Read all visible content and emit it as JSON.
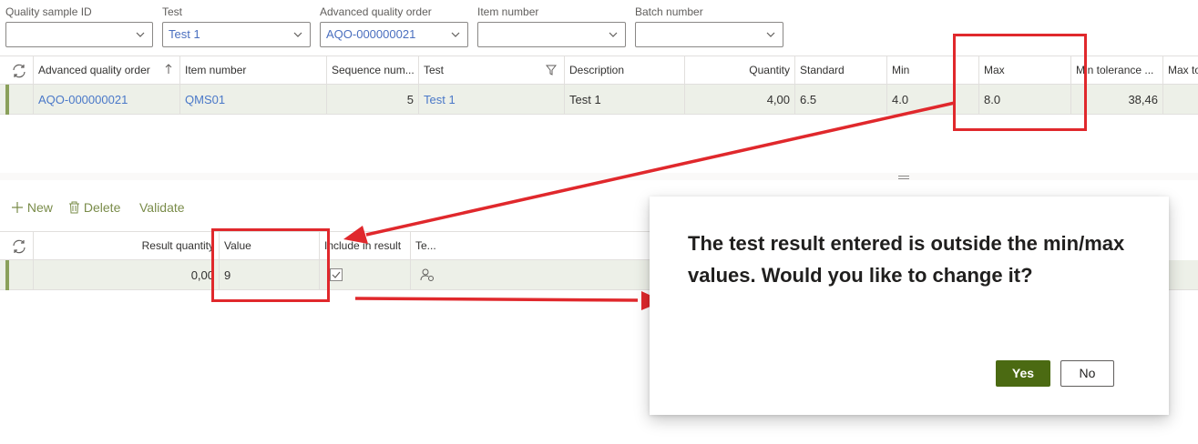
{
  "filters": [
    {
      "label": "Quality sample ID",
      "value": ""
    },
    {
      "label": "Test",
      "value": "Test 1"
    },
    {
      "label": "Advanced quality order",
      "value": "AQO-000000021"
    },
    {
      "label": "Item number",
      "value": ""
    },
    {
      "label": "Batch number",
      "value": ""
    }
  ],
  "top_grid": {
    "headers": [
      "Advanced quality order",
      "Item number",
      "Sequence num...",
      "Test",
      "Description",
      "Quantity",
      "Standard",
      "Min",
      "Max",
      "Min tolerance ...",
      "Max to"
    ],
    "row": [
      "AQO-000000021",
      "QMS01",
      "5",
      "Test 1",
      "Test 1",
      "4,00",
      "6.5",
      "4.0",
      "8.0",
      "38,46",
      ""
    ]
  },
  "toolbar": {
    "new": "New",
    "delete": "Delete",
    "validate": "Validate"
  },
  "bottom_grid": {
    "headers": [
      "Result quantity",
      "Value",
      "Include in result",
      "Te..."
    ],
    "row": [
      "0,00",
      "9"
    ]
  },
  "dialog": {
    "message": "The test result entered is outside the min/max values. Would you like to change it?",
    "yes": "Yes",
    "no": "No"
  },
  "colors": {
    "accent": "#4b6a12",
    "link": "#4a78c8",
    "annotation": "#e0282c"
  }
}
